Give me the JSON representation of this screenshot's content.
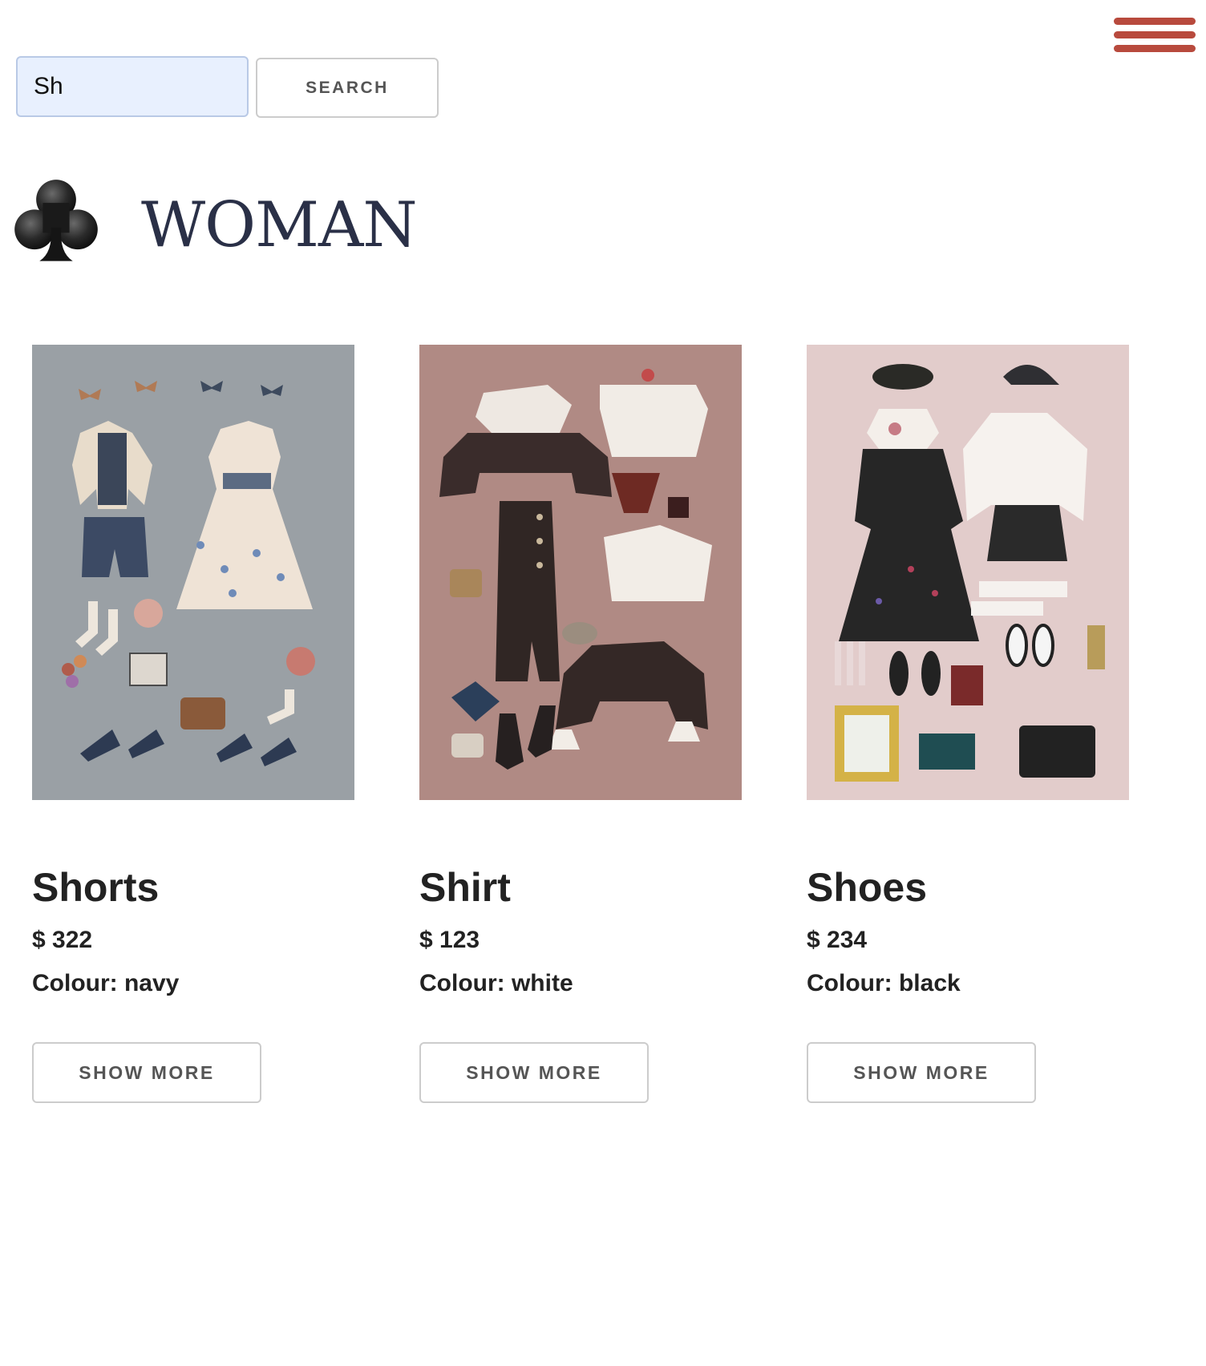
{
  "nav": {
    "menu_icon": "hamburger-menu-icon",
    "menu_color": "#b84a3d"
  },
  "search": {
    "value": "Sh",
    "button_label": "SEARCH"
  },
  "heading": {
    "icon": "club-suit-icon",
    "title": "WOMAN"
  },
  "products": [
    {
      "name": "Shorts",
      "price": "$ 322",
      "colour": "Colour: navy",
      "button_label": "SHOW MORE",
      "image_background": "#9aa0a5"
    },
    {
      "name": "Shirt",
      "price": "$ 123",
      "colour": "Colour: white",
      "button_label": "SHOW MORE",
      "image_background": "#b08a84"
    },
    {
      "name": "Shoes",
      "price": "$ 234",
      "colour": "Colour: black",
      "button_label": "SHOW MORE",
      "image_background": "#e2cccb"
    }
  ]
}
